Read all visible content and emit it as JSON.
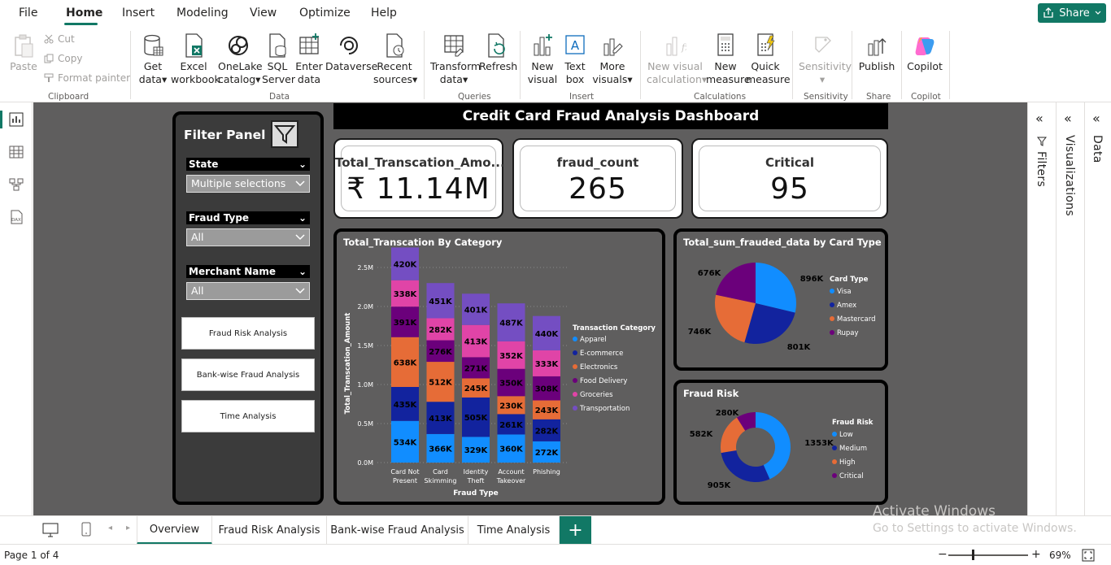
{
  "menu": {
    "file": "File",
    "home": "Home",
    "insert": "Insert",
    "modeling": "Modeling",
    "view": "View",
    "optimize": "Optimize",
    "help": "Help",
    "share": "Share"
  },
  "ribbon": {
    "paste": "Paste",
    "cut": "Cut",
    "copy": "Copy",
    "format_painter": "Format painter",
    "get_data": [
      "Get",
      "data"
    ],
    "excel": [
      "Excel",
      "workbook"
    ],
    "onelake": [
      "OneLake",
      "catalog"
    ],
    "sql": [
      "SQL",
      "Server"
    ],
    "enter": [
      "Enter",
      "data"
    ],
    "dataverse": "Dataverse",
    "recent": [
      "Recent",
      "sources"
    ],
    "transform": [
      "Transform",
      "data"
    ],
    "refresh": "Refresh",
    "new_visual": [
      "New",
      "visual"
    ],
    "text_box": [
      "Text",
      "box"
    ],
    "more_visuals": [
      "More",
      "visuals"
    ],
    "new_visual_calc": [
      "New visual",
      "calculation"
    ],
    "new_measure": [
      "New",
      "measure"
    ],
    "quick_measure": [
      "Quick",
      "measure"
    ],
    "sensitivity": "Sensitivity",
    "publish": "Publish",
    "copilot": "Copilot",
    "groups": {
      "clipboard": "Clipboard",
      "data": "Data",
      "queries": "Queries",
      "insert": "Insert",
      "calculations": "Calculations",
      "sensitivity": "Sensitivity",
      "share": "Share",
      "copilot": "Copilot"
    }
  },
  "panes": {
    "filters": "Filters",
    "visualizations": "Visualizations",
    "data": "Data"
  },
  "dashboard": {
    "title": "Credit Card Fraud Analysis Dashboard",
    "filter_panel": {
      "title": "Filter Panel",
      "slicers": [
        {
          "label": "State",
          "value": "Multiple selections"
        },
        {
          "label": "Fraud Type",
          "value": "All"
        },
        {
          "label": "Merchant Name",
          "value": "All"
        }
      ],
      "buttons": [
        "Fraud Risk Analysis",
        "Bank-wise Fraud Analysis",
        "Time Analysis"
      ]
    },
    "cards": [
      {
        "title": "Total_Transcation_Amo...",
        "value": "₹ 11.14M"
      },
      {
        "title": "fraud_count",
        "value": "265"
      },
      {
        "title": "Critical",
        "value": "95"
      }
    ]
  },
  "chart_data": [
    {
      "type": "bar",
      "stacked": true,
      "title": "Total_Transcation By Category",
      "xlabel": "Fraud Type",
      "ylabel": "Total_Transcation_Amount",
      "categories": [
        [
          "Card Not",
          "Present"
        ],
        [
          "Card",
          "Skimming"
        ],
        [
          "Identity",
          "Theft"
        ],
        [
          "Account",
          "Takeover"
        ],
        [
          "Phishing"
        ]
      ],
      "yticks": [
        "0.0M",
        "0.5M",
        "1.0M",
        "1.5M",
        "2.0M",
        "2.5M"
      ],
      "ylim": [
        0,
        2750000
      ],
      "legend_title": "Transaction Category",
      "series": [
        {
          "name": "Apparel",
          "color": "#118dff",
          "values": [
            534000,
            366000,
            329000,
            360000,
            272000
          ],
          "labels": [
            "534K",
            "366K",
            "329K",
            "360K",
            "272K"
          ]
        },
        {
          "name": "E-commerce",
          "color": "#12239e",
          "values": [
            435000,
            413000,
            505000,
            261000,
            282000
          ],
          "labels": [
            "435K",
            "413K",
            "505K",
            "261K",
            "282K"
          ]
        },
        {
          "name": "Electronics",
          "color": "#e66c37",
          "values": [
            638000,
            512000,
            245000,
            230000,
            243000
          ],
          "labels": [
            "638K",
            "512K",
            "245K",
            "230K",
            "243K"
          ]
        },
        {
          "name": "Food Delivery",
          "color": "#6b007b",
          "values": [
            391000,
            276000,
            271000,
            350000,
            308000
          ],
          "labels": [
            "391K",
            "276K",
            "271K",
            "350K",
            "308K"
          ]
        },
        {
          "name": "Groceries",
          "color": "#e044a7",
          "values": [
            338000,
            282000,
            413000,
            352000,
            333000
          ],
          "labels": [
            "338K",
            "282K",
            "413K",
            "352K",
            "333K"
          ]
        },
        {
          "name": "Transportation",
          "color": "#744ec2",
          "values": [
            420000,
            451000,
            401000,
            487000,
            440000
          ],
          "labels": [
            "420K",
            "451K",
            "401K",
            "487K",
            "440K"
          ]
        }
      ]
    },
    {
      "type": "pie",
      "title": "Total_sum_frauded_data by Card Type",
      "legend_title": "Card Type",
      "slices": [
        {
          "name": "Visa",
          "value": 896000,
          "label": "896K",
          "color": "#118dff"
        },
        {
          "name": "Amex",
          "value": 801000,
          "label": "801K",
          "color": "#12239e"
        },
        {
          "name": "Mastercard",
          "value": 746000,
          "label": "746K",
          "color": "#e66c37"
        },
        {
          "name": "Rupay",
          "value": 676000,
          "label": "676K",
          "color": "#6b007b"
        }
      ]
    },
    {
      "type": "pie",
      "donut": true,
      "title": "Fraud Risk",
      "legend_title": "Fraud Risk",
      "slices": [
        {
          "name": "Low",
          "value": 1353000,
          "label": "1353K",
          "color": "#118dff"
        },
        {
          "name": "Medium",
          "value": 905000,
          "label": "905K",
          "color": "#12239e"
        },
        {
          "name": "High",
          "value": 582000,
          "label": "582K",
          "color": "#e66c37"
        },
        {
          "name": "Critical",
          "value": 280000,
          "label": "280K",
          "color": "#6b007b"
        }
      ]
    }
  ],
  "tabs": [
    "Overview",
    "Fraud Risk Analysis",
    "Bank-wise Fraud Analysis",
    "Time Analysis"
  ],
  "status": {
    "page": "Page 1 of 4",
    "zoom": "69%"
  },
  "watermark": {
    "line1": "Activate Windows",
    "line2": "Go to Settings to activate Windows."
  }
}
